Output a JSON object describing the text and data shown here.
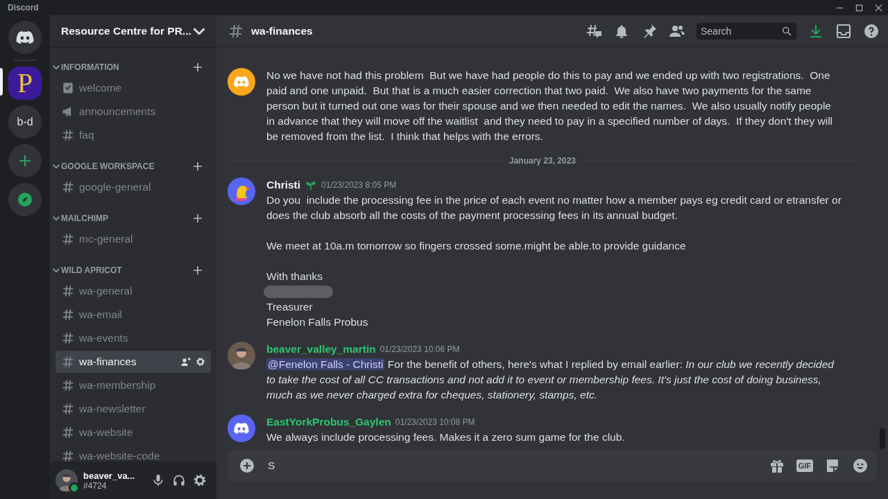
{
  "window": {
    "title": "Discord"
  },
  "servers": [
    {
      "kind": "home",
      "selected": false
    },
    {
      "kind": "logo",
      "label": "P",
      "selected": true
    },
    {
      "kind": "initials",
      "label": "b-d",
      "selected": false
    },
    {
      "kind": "add",
      "selected": false
    },
    {
      "kind": "explore",
      "selected": false
    }
  ],
  "server_name": "Resource Centre for PR...",
  "categories": [
    {
      "name": "INFORMATION",
      "expanded": true,
      "channels": [
        {
          "name": "welcome",
          "kind": "rules",
          "selected": false
        },
        {
          "name": "announcements",
          "kind": "announcement",
          "selected": false
        },
        {
          "name": "faq",
          "kind": "text",
          "selected": false
        }
      ]
    },
    {
      "name": "GOOGLE WORKSPACE",
      "expanded": true,
      "channels": [
        {
          "name": "google-general",
          "kind": "text",
          "selected": false
        }
      ]
    },
    {
      "name": "MAILCHIMP",
      "expanded": true,
      "channels": [
        {
          "name": "mc-general",
          "kind": "text",
          "selected": false
        }
      ]
    },
    {
      "name": "WILD APRICOT",
      "expanded": true,
      "channels": [
        {
          "name": "wa-general",
          "kind": "text",
          "selected": false
        },
        {
          "name": "wa-email",
          "kind": "text",
          "selected": false
        },
        {
          "name": "wa-events",
          "kind": "text",
          "selected": false
        },
        {
          "name": "wa-finances",
          "kind": "text",
          "selected": true
        },
        {
          "name": "wa-membership",
          "kind": "text",
          "selected": false
        },
        {
          "name": "wa-newsletter",
          "kind": "text",
          "selected": false
        },
        {
          "name": "wa-website",
          "kind": "text",
          "selected": false
        },
        {
          "name": "wa-website-code",
          "kind": "text",
          "selected": false
        }
      ]
    }
  ],
  "user": {
    "name": "beaver_va...",
    "tag": "#4724",
    "online": true
  },
  "channel": {
    "name": "wa-finances"
  },
  "search": {
    "placeholder": "Search"
  },
  "feed": [
    {
      "kind": "message",
      "avatar": {
        "kind": "discord",
        "color": "#faa61a"
      },
      "lines": [
        {
          "kind": "text",
          "text": "No we have not had this problem  But we have had people do this to pay and we ended up with two registrations.  One paid and one unpaid.  But that is a much easier correction that two paid.  We also have two payments for the same person but it turned out one was for their spouse and we then needed to edit the names.  We also usually notify people in advance that they will move off the waitlist  and they need to pay in a specified number of days.  If they don't they will be removed from the list.  I think that helps with the errors."
        }
      ]
    },
    {
      "kind": "divider",
      "text": "January 23, 2023"
    },
    {
      "kind": "message",
      "avatar": {
        "kind": "bird",
        "color": "#5865f2"
      },
      "author": "Christi",
      "color": "#f2f3f5",
      "new_member_badge": true,
      "timestamp": "01/23/2023 8:05 PM",
      "lines": [
        {
          "kind": "text",
          "text": "Do you  include the processing fee in the price of each event no matter how a member pays eg credit card or etransfer or does the club absorb all the costs of the payment processing fees in its annual budget."
        },
        {
          "kind": "blank"
        },
        {
          "kind": "text",
          "text": "We meet at 10a.m tomorrow so fingers crossed some.might be able.to provide guidance"
        },
        {
          "kind": "blank"
        },
        {
          "kind": "text",
          "text": "With thanks"
        },
        {
          "kind": "redacted"
        },
        {
          "kind": "text",
          "text": "Treasurer"
        },
        {
          "kind": "text",
          "text": "Fenelon Falls Probus"
        }
      ]
    },
    {
      "kind": "message",
      "avatar": {
        "kind": "photo",
        "color": "#6b5a4e"
      },
      "author": "beaver_valley_martin",
      "color": "#2dc770",
      "new_member_badge": false,
      "timestamp": "01/23/2023 10:06 PM",
      "lines": [
        {
          "kind": "text",
          "mention": "@Fenelon Falls - Christi",
          "text": "For the benefit of others, here's what I replied by email earlier: *In our club we recently decided to take the cost of all CC transactions and not add it to event or membership fees. It's just the cost of doing business, much as we never charged extra for cheques, stationery, stamps, etc.*"
        }
      ]
    },
    {
      "kind": "message",
      "avatar": {
        "kind": "discord",
        "color": "#5865f2"
      },
      "author": "EastYorkProbus_Gaylen",
      "color": "#2dc770",
      "new_member_badge": false,
      "timestamp": "01/23/2023 10:08 PM",
      "lines": [
        {
          "kind": "text",
          "text": "We always include processing fees. Makes it a zero sum game for the club."
        }
      ]
    }
  ],
  "composer": {
    "value": "S",
    "gif_label": "GIF"
  }
}
